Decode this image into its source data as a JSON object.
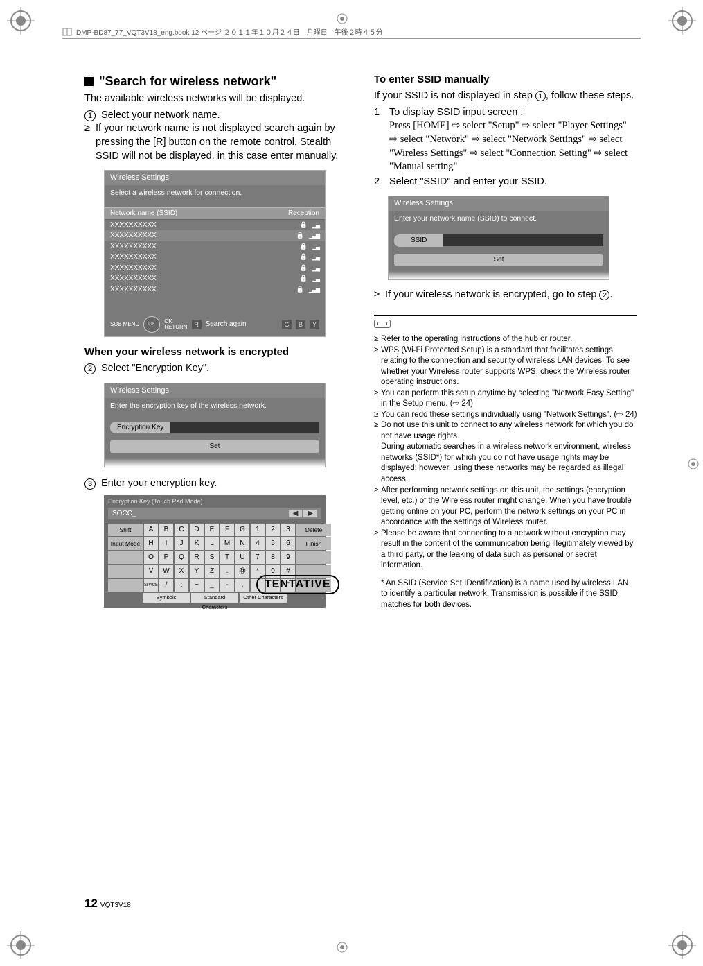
{
  "header": "DMP-BD87_77_VQT3V18_eng.book  12 ページ  ２０１１年１０月２４日　月曜日　午後２時４５分",
  "left": {
    "h": "\"Search for wireless network\"",
    "p1": "The available wireless networks will be displayed.",
    "s1": "Select your network name.",
    "b1": "If your network name is not displayed search again by pressing the [R] button on the remote control. Stealth SSID will not be displayed, in this case enter manually.",
    "screen1": {
      "title": "Wireless Settings",
      "sub": "Select a wireless network for connection.",
      "colA": "Network name (SSID)",
      "colB": "Reception",
      "row": "XXXXXXXXXX",
      "ok": "OK",
      "ret": "RETURN",
      "submenu": "SUB MENU",
      "r": "R",
      "search": "Search again",
      "g": "G",
      "b": "B",
      "y": "Y"
    },
    "sub2": "When your wireless network is encrypted",
    "s2": "Select \"Encryption Key\".",
    "screen2": {
      "title": "Wireless Settings",
      "sub": "Enter the encryption key of the wireless network.",
      "label": "Encryption Key",
      "set": "Set"
    },
    "s3": "Enter your encryption key.",
    "kb": {
      "title": "Encryption Key (Touch Pad Mode)",
      "input": "SOCC_",
      "arrL": "◀",
      "arrR": "▶",
      "shift": "Shift",
      "inputmode": "Input Mode",
      "delete": "Delete",
      "finish": "Finish",
      "space": "SPACE",
      "row1": [
        "A",
        "B",
        "C",
        "D",
        "E",
        "F",
        "G",
        "1",
        "2",
        "3"
      ],
      "row2": [
        "H",
        "I",
        "J",
        "K",
        "L",
        "M",
        "N",
        "4",
        "5",
        "6"
      ],
      "row3": [
        "O",
        "P",
        "Q",
        "R",
        "S",
        "T",
        "U",
        "7",
        "8",
        "9"
      ],
      "row4": [
        "V",
        "W",
        "X",
        "Y",
        "Z",
        ".",
        "@",
        "*",
        "0",
        "#"
      ],
      "row5": [
        "/",
        ":",
        "~",
        "_",
        "-",
        ",",
        ";",
        "'",
        "\""
      ],
      "bottom": [
        "Symbols",
        "Standard Characters",
        "Other Characters"
      ],
      "tentative": "TENTATIVE"
    }
  },
  "right": {
    "h": "To enter SSID manually",
    "p1a": "If your SSID is not displayed in step ",
    "p1b": ", follow these steps.",
    "st1": "To display SSID input screen :",
    "st1b": "Press [HOME] ⇨ select \"Setup\" ⇨ select \"Player Settings\" ⇨ select \"Network\" ⇨ select \"Network Settings\" ⇨ select \"Wireless Settings\" ⇨ select \"Connection Setting\" ⇨ select \"Manual setting\"",
    "st2": "Select \"SSID\" and enter your SSID.",
    "screen3": {
      "title": "Wireless Settings",
      "sub": "Enter your network name (SSID) to connect.",
      "label": "SSID",
      "set": "Set"
    },
    "b2a": "If your wireless network is encrypted, go to step ",
    "b2b": ".",
    "notes": [
      "Refer to the operating instructions of the hub or router.",
      "WPS (Wi-Fi Protected Setup) is a standard that facilitates settings relating to the connection and security of wireless LAN devices. To see whether your Wireless router supports WPS, check the Wireless router operating instructions.",
      "You can perform this setup anytime by selecting \"Network Easy Setting\" in the Setup menu. (⇨ 24)",
      "You can redo these settings individually using \"Network Settings\". (⇨ 24)",
      "Do not use this unit to connect to any wireless network for which you do not have usage rights.\nDuring automatic searches in a wireless network environment, wireless networks (SSID*) for which you do not have usage rights may be displayed; however, using these networks may be regarded as illegal access.",
      "After performing network settings on this unit, the settings (encryption level, etc.) of the Wireless router might change. When you have trouble getting online on your PC, perform the network settings on your PC in accordance with the settings of Wireless router.",
      "Please be aware that connecting to a network without encryption may result in the content of the communication being illegitimately viewed by a third party, or the leaking of data such as personal or secret information."
    ],
    "star": "* An SSID (Service Set IDentification) is a name used by wireless LAN to identify a particular network. Transmission is possible if the SSID matches for both devices."
  },
  "footer": {
    "page": "12",
    "code": "VQT3V18"
  }
}
